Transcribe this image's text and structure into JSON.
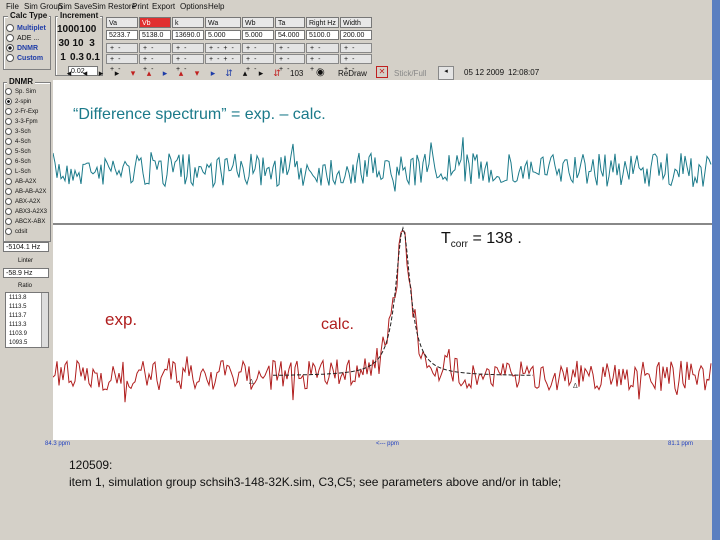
{
  "menu": [
    "File",
    "Sim Group",
    "Sim Save",
    "Sim Restore",
    "Print",
    "Export",
    "Options",
    "Help"
  ],
  "calc_type": {
    "title": "Calc Type",
    "options": [
      {
        "label": "Multiplet",
        "selected": false
      },
      {
        "label": "ADE ...",
        "selected": false
      },
      {
        "label": "DNMR",
        "selected": true
      },
      {
        "label": "Custom",
        "selected": false
      }
    ]
  },
  "increment": {
    "title": "Increment",
    "values": [
      [
        "1000",
        "100"
      ],
      [
        "30",
        "10",
        "3"
      ],
      [
        "1",
        "0.3",
        "0.1"
      ]
    ],
    "field": "0.02"
  },
  "dnmr": {
    "title": "DNMR",
    "options": [
      "Sp. Sim",
      "2-spin",
      "2-Fr-Exp",
      "3-3-Fpm",
      "3-Sch",
      "4-Sch",
      "5-Sch",
      "6-Sch",
      "L-Sch",
      "AB-A2X",
      "AB-AB-A2X",
      "ABX-A2X",
      "ABX3-A2X3",
      "ABCX-ABX",
      "cdsit"
    ],
    "selected": 1,
    "field_label": "-5104.1 Hz",
    "linter_label": "Linter",
    "linter_value": "-58.9 Hz",
    "ratio_label": "Ratio"
  },
  "ratio_values": [
    "1113.8",
    "1113.5",
    "1113.7",
    "1113.3",
    "1103.9",
    "1093.5"
  ],
  "params": {
    "headers": [
      "Va",
      "Vb",
      "k ab+kba",
      "Wa",
      "Wb",
      "Ta",
      "Right Hz",
      "Width Hz"
    ],
    "values": [
      "5233.7",
      "5138.0",
      "13690.0",
      "5.000",
      "5.000",
      "54.000",
      "5100.0",
      "200.00"
    ]
  },
  "toolbar": {
    "field_value": "103",
    "redraw": "ReDraw",
    "stick_full": "Stick/Full",
    "date": "05 12 2009",
    "time": "12:08:07"
  },
  "plot": {
    "diff_title": "“Difference spectrum” = exp. – calc.",
    "tcorr_label": "T",
    "tcorr_sub": "corr",
    "tcorr_value": " = 138 .",
    "exp_label": "exp.",
    "calc_label": "calc.",
    "colors": {
      "diff": "#1b7a8a",
      "exp": "#b01e1e",
      "calc": "#222222",
      "title": "#1b7a8a"
    },
    "axis_left": "84.3 ppm",
    "axis_mid": "<--- ppm",
    "axis_right": "81.1 ppm"
  },
  "footer": {
    "line1": "120509:",
    "line2": "item 1, simulation group schsih3-148-32K.sim,  C3,C5; see parameters above and/or in table;"
  }
}
